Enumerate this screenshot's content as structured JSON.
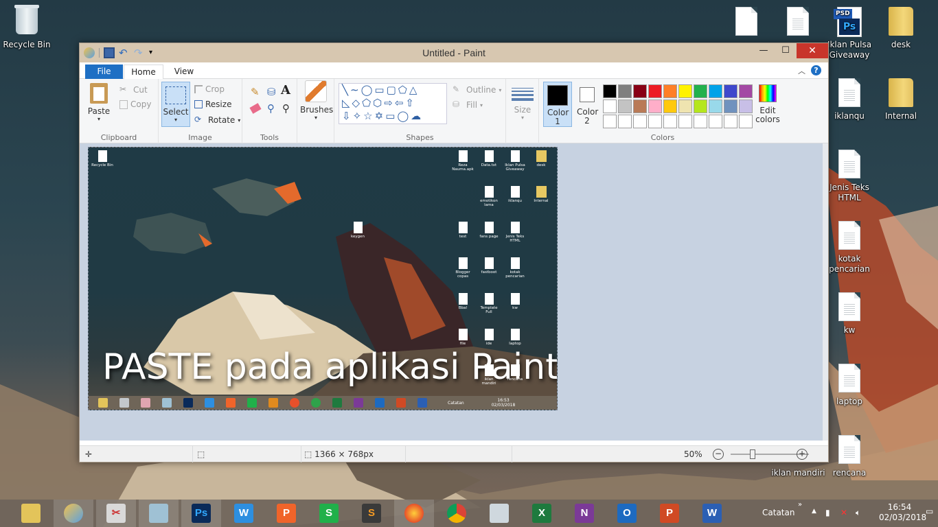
{
  "desktop": {
    "icons": [
      {
        "label": "Recycle Bin"
      },
      {
        "label": "Iklan Pulsa Giveaway"
      },
      {
        "label": "desk"
      },
      {
        "label": "iklanqu"
      },
      {
        "label": "Internal"
      },
      {
        "label": "Jenis Teks HTML"
      },
      {
        "label": "kotak pencarian"
      },
      {
        "label": "kw"
      },
      {
        "label": "laptop"
      },
      {
        "label": "rencana"
      },
      {
        "label": "iklan mandiri"
      }
    ]
  },
  "paint": {
    "title": "Untitled - Paint",
    "tabs": {
      "file": "File",
      "home": "Home",
      "view": "View"
    },
    "clipboard": {
      "group": "Clipboard",
      "paste": "Paste",
      "cut": "Cut",
      "copy": "Copy"
    },
    "image": {
      "group": "Image",
      "select": "Select",
      "crop": "Crop",
      "resize": "Resize",
      "rotate": "Rotate"
    },
    "tools": {
      "group": "Tools"
    },
    "brushes": {
      "label": "Brushes"
    },
    "shapes": {
      "group": "Shapes",
      "outline": "Outline",
      "fill": "Fill"
    },
    "size": {
      "label": "Size"
    },
    "colors": {
      "group": "Colors",
      "color1": "Color 1",
      "color2": "Color 2",
      "edit": "Edit colors",
      "row1": [
        "#000000",
        "#7f7f7f",
        "#880015",
        "#ed1c24",
        "#ff7f27",
        "#fff200",
        "#22b14c",
        "#00a2e8",
        "#3f48cc",
        "#a349a4"
      ],
      "row2": [
        "#ffffff",
        "#c3c3c3",
        "#b97a57",
        "#ffaec9",
        "#ffc90e",
        "#efe4b0",
        "#b5e61d",
        "#99d9ea",
        "#7092be",
        "#c8bfe7"
      ],
      "row3": [
        "#ffffff",
        "#ffffff",
        "#ffffff",
        "#ffffff",
        "#ffffff",
        "#ffffff",
        "#ffffff",
        "#ffffff",
        "#ffffff",
        "#ffffff"
      ]
    },
    "status": {
      "dimensions": "1366 × 768px",
      "zoom": "50%"
    },
    "pasted": {
      "caption": "PASTE pada aplikasi Paint",
      "icons": [
        "Recycle Bin",
        "Reza Nauma.apk",
        "Data.txt",
        "Iklan Pulsa Giveaway",
        "desk",
        "emotikon lama",
        "iklanqu",
        "Internal",
        "keygen",
        "test",
        "fans page",
        "Jenis Teks HTML",
        "Blogger copas",
        "fastboot",
        "kotak pencarian",
        "Bbal",
        "Template Full",
        "kw",
        "file",
        "ide",
        "laptop",
        "iklan mandiri",
        "rencana"
      ],
      "tray_label": "Catatan",
      "time": "16:53",
      "date": "02/03/2018"
    }
  },
  "taskbar": {
    "tray_label": "Catatan",
    "time": "16:54",
    "date": "02/03/2018"
  }
}
